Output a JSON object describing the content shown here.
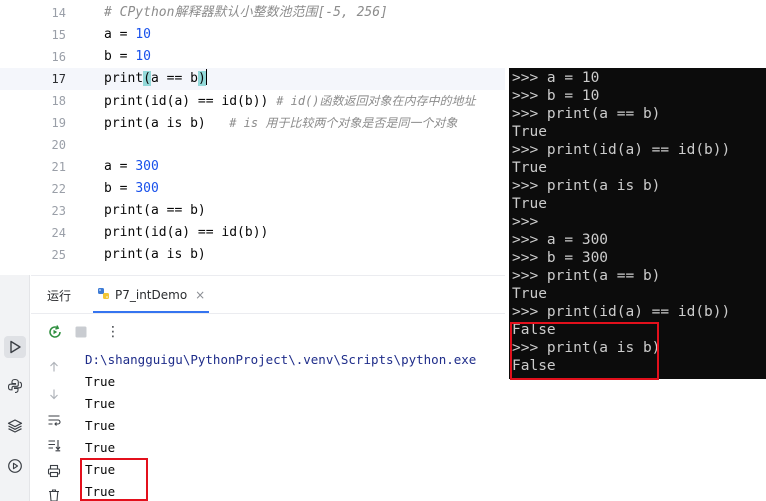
{
  "editor": {
    "lines": [
      {
        "no": "14",
        "comment": "# CPython解释器默认小整数池范围[-5, 256]"
      },
      {
        "no": "15",
        "var": "a",
        "op": " = ",
        "value": "10"
      },
      {
        "no": "16",
        "var": "b",
        "op": " = ",
        "value": "10"
      },
      {
        "no": "17",
        "fn": "print",
        "open": "(",
        "args": "a == b",
        "close": ")"
      },
      {
        "no": "18",
        "code": "print(id(a) == id(b)) ",
        "comment": "# id()函数返回对象在内存中的地址"
      },
      {
        "no": "19",
        "code": "print(a is b)   ",
        "comment": "# is 用于比较两个对象是否是同一个对象"
      },
      {
        "no": "20"
      },
      {
        "no": "21",
        "var": "a",
        "op": " = ",
        "value": "300"
      },
      {
        "no": "22",
        "var": "b",
        "op": " = ",
        "value": "300"
      },
      {
        "no": "23",
        "code": "print(a == b)"
      },
      {
        "no": "24",
        "code": "print(id(a) == id(b))"
      },
      {
        "no": "25",
        "code": "print(a is b)"
      }
    ]
  },
  "run_panel": {
    "title": "运行",
    "tab_label": "P7_intDemo",
    "tab_close": "×",
    "console_lines": [
      "D:\\shangguigu\\PythonProject\\.venv\\Scripts\\python.exe",
      "True",
      "True",
      "True",
      "True",
      "True",
      "True"
    ]
  },
  "toolbar": {
    "rerun_icon": "rerun-icon",
    "stop_icon": "stop-icon",
    "more_label": "⋮"
  },
  "terminal": {
    "lines": [
      ">>> a = 10",
      ">>> b = 10",
      ">>> print(a == b)",
      "True",
      ">>> print(id(a) == id(b))",
      "True",
      ">>> print(a is b)",
      "True",
      ">>>",
      ">>> a = 300",
      ">>> b = 300",
      ">>> print(a == b)",
      "True",
      ">>> print(id(a) == id(b))",
      "False",
      ">>> print(a is b)",
      "False"
    ]
  },
  "colors": {
    "highlight_box": "#e3101c",
    "keyword": "#0033b3",
    "number": "#1750eb",
    "comment": "#8c8c8c",
    "terminal_bg": "#0c0c0c",
    "terminal_text": "#cccccc",
    "accent": "#3574f0"
  }
}
